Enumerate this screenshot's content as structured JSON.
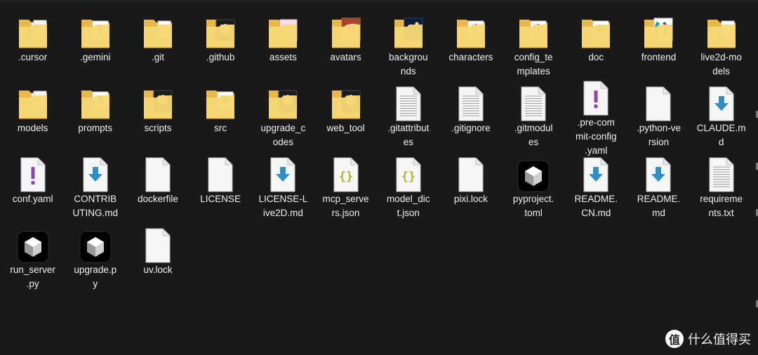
{
  "files": [
    {
      "label": ".cursor",
      "icon": "folder-icon",
      "overlay": "stack"
    },
    {
      "label": ".gemini",
      "icon": "folder-icon",
      "overlay": "doc-blue"
    },
    {
      "label": ".git",
      "icon": "folder-icon",
      "overlay": "paper"
    },
    {
      "label": ".github",
      "icon": "folder-icon",
      "overlay": "dark-app"
    },
    {
      "label": "assets",
      "icon": "folder-icon",
      "overlay": "pink-image"
    },
    {
      "label": "avatars",
      "icon": "folder-icon",
      "overlay": "anime-image"
    },
    {
      "label": "backgrounds",
      "icon": "folder-icon",
      "overlay": "night-image"
    },
    {
      "label": "characters",
      "icon": "folder-icon",
      "overlay": "doc-purple"
    },
    {
      "label": "config_templates",
      "icon": "folder-icon",
      "overlay": "doc-purple"
    },
    {
      "label": "doc",
      "icon": "folder-icon",
      "overlay": "doc-blue"
    },
    {
      "label": "frontend",
      "icon": "folder-icon",
      "overlay": "teal-image"
    },
    {
      "label": "live2d-models",
      "icon": "folder-icon",
      "overlay": "paper"
    },
    {
      "label": "models",
      "icon": "folder-icon",
      "overlay": "stack"
    },
    {
      "label": "prompts",
      "icon": "folder-icon",
      "overlay": "doc-blue"
    },
    {
      "label": "scripts",
      "icon": "folder-icon",
      "overlay": "dark-app"
    },
    {
      "label": "src",
      "icon": "folder-icon",
      "overlay": "doc-blue"
    },
    {
      "label": "upgrade_codes",
      "icon": "folder-icon",
      "overlay": "dark-app"
    },
    {
      "label": "web_tool",
      "icon": "folder-icon",
      "overlay": "dark-app"
    },
    {
      "label": ".gitattributes",
      "icon": "text-file-icon"
    },
    {
      "label": ".gitignore",
      "icon": "text-file-icon"
    },
    {
      "label": ".gitmodules",
      "icon": "text-file-icon"
    },
    {
      "label": ".pre-commit-config.yaml",
      "icon": "yaml-file-icon"
    },
    {
      "label": ".python-version",
      "icon": "blank-file-icon"
    },
    {
      "label": "CLAUDE.md",
      "icon": "markdown-file-icon"
    },
    {
      "label": "conf.yaml",
      "icon": "yaml-file-icon"
    },
    {
      "label": "CONTRIBUTING.md",
      "icon": "markdown-file-icon"
    },
    {
      "label": "dockerfile",
      "icon": "blank-file-icon"
    },
    {
      "label": "LICENSE",
      "icon": "blank-file-icon"
    },
    {
      "label": "LICENSE-Live2D.md",
      "icon": "markdown-file-icon"
    },
    {
      "label": "mcp_servers.json",
      "icon": "json-file-icon"
    },
    {
      "label": "model_dict.json",
      "icon": "json-file-icon"
    },
    {
      "label": "pixi.lock",
      "icon": "blank-file-icon"
    },
    {
      "label": "pyproject.toml",
      "icon": "cube-app-icon"
    },
    {
      "label": "README.CN.md",
      "icon": "markdown-file-icon"
    },
    {
      "label": "README.md",
      "icon": "markdown-file-icon"
    },
    {
      "label": "requirements.txt",
      "icon": "text-file-icon"
    },
    {
      "label": "run_server.py",
      "icon": "cube-app-icon"
    },
    {
      "label": "upgrade.py",
      "icon": "cube-app-icon"
    },
    {
      "label": "uv.lock",
      "icon": "blank-file-icon"
    }
  ],
  "watermark": {
    "badge": "值",
    "text": "什么值得买"
  }
}
